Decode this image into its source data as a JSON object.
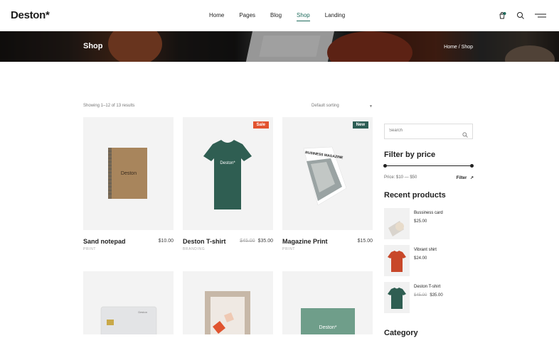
{
  "header": {
    "logo": "Deston*",
    "nav": [
      "Home",
      "Pages",
      "Blog",
      "Shop",
      "Landing"
    ],
    "active_nav": "Shop",
    "icons": [
      "cart-icon",
      "search-icon",
      "menu-icon"
    ]
  },
  "banner": {
    "title": "Shop",
    "breadcrumb": "Home / Shop"
  },
  "toolbar": {
    "result_count": "Showing 1–12 of 13 results",
    "sorting": "Default sorting"
  },
  "products": [
    {
      "name": "Sand notepad",
      "price": "$10.00",
      "old_price": "",
      "category": "PRINT",
      "badge": ""
    },
    {
      "name": "Deston T-shirt",
      "price": "$35.00",
      "old_price": "$45.00",
      "category": "BRANDING",
      "badge": "Sale"
    },
    {
      "name": "Magazine Print",
      "price": "$15.00",
      "old_price": "",
      "category": "PRINT",
      "badge": "New"
    }
  ],
  "product_images": {
    "notepad_text": "Deston",
    "tshirt_text": "Deston*",
    "magazine_text": "BUSINESS MAGAZINE",
    "card_text": "Deston",
    "green_text": "Deston*"
  },
  "sidebar": {
    "search_placeholder": "Search",
    "filter_title": "Filter by price",
    "price_range": "Price: $10 — $50",
    "filter_button": "Filter",
    "recent_title": "Recent products",
    "recent": [
      {
        "name": "Bussiness card",
        "price": "$25.00",
        "old_price": ""
      },
      {
        "name": "Vibrant shirt",
        "price": "$24.00",
        "old_price": ""
      },
      {
        "name": "Deston T-shirt",
        "price": "$35.00",
        "old_price": "$45.00"
      }
    ],
    "category_title": "Category"
  },
  "colors": {
    "accent": "#1e6b5c",
    "sale_badge": "#e2532f",
    "new_badge": "#2d5e55",
    "shirt_green": "#2f5e52",
    "shirt_orange": "#c8482a"
  }
}
